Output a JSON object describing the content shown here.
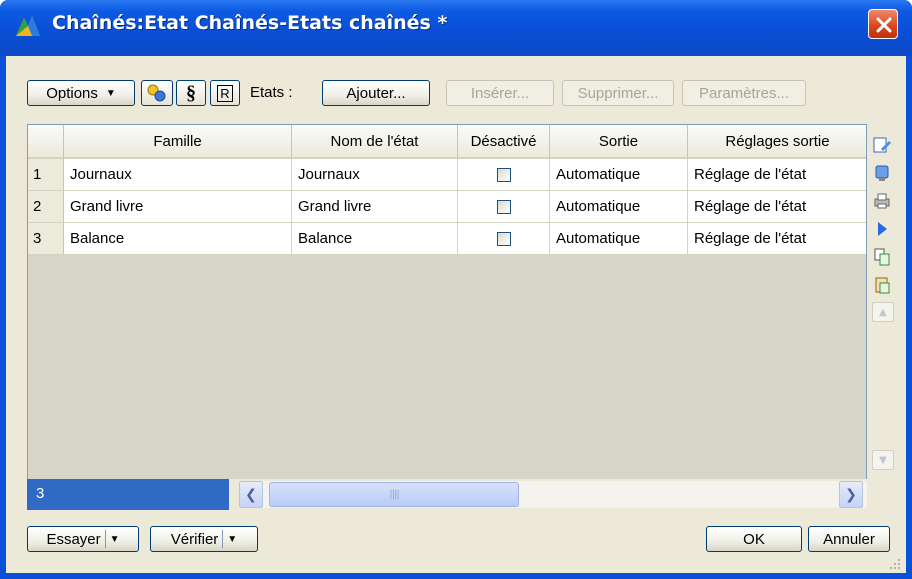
{
  "window": {
    "title": "Chaînés:Etat Chaînés-Etats chaînés *"
  },
  "toolbar": {
    "options_label": "Options",
    "section_symbol": "§",
    "r_label": "R",
    "etats_label": "Etats :",
    "ajouter_label": "Ajouter...",
    "inserer_label": "Insérer...",
    "supprimer_label": "Supprimer...",
    "parametres_label": "Paramètres..."
  },
  "table": {
    "headers": [
      "Famille",
      "Nom de l'état",
      "Désactivé",
      "Sortie",
      "Réglages sortie"
    ],
    "rows": [
      {
        "num": "1",
        "famille": "Journaux",
        "nom": "Journaux",
        "desactive": false,
        "sortie": "Automatique",
        "reglages": "Réglage de l'état"
      },
      {
        "num": "2",
        "famille": "Grand livre",
        "nom": "Grand livre",
        "desactive": false,
        "sortie": "Automatique",
        "reglages": "Réglage de l'état"
      },
      {
        "num": "3",
        "famille": "Balance",
        "nom": "Balance",
        "desactive": false,
        "sortie": "Automatique",
        "reglages": "Réglage de l'état"
      }
    ]
  },
  "status": {
    "row_count": "3"
  },
  "footer": {
    "essayer_label": "Essayer",
    "verifier_label": "Vérifier",
    "ok_label": "OK",
    "annuler_label": "Annuler"
  },
  "icons": {
    "app": "app-chain-icon",
    "close": "close-icon",
    "side": [
      "edit-icon",
      "storage-icon",
      "printer-icon",
      "play-icon",
      "copy-icon",
      "paste-icon"
    ]
  },
  "colors": {
    "titlebar": "#0a50d8",
    "selection": "#316ac5",
    "close": "#d9441a",
    "dialog": "#ece9d8"
  }
}
